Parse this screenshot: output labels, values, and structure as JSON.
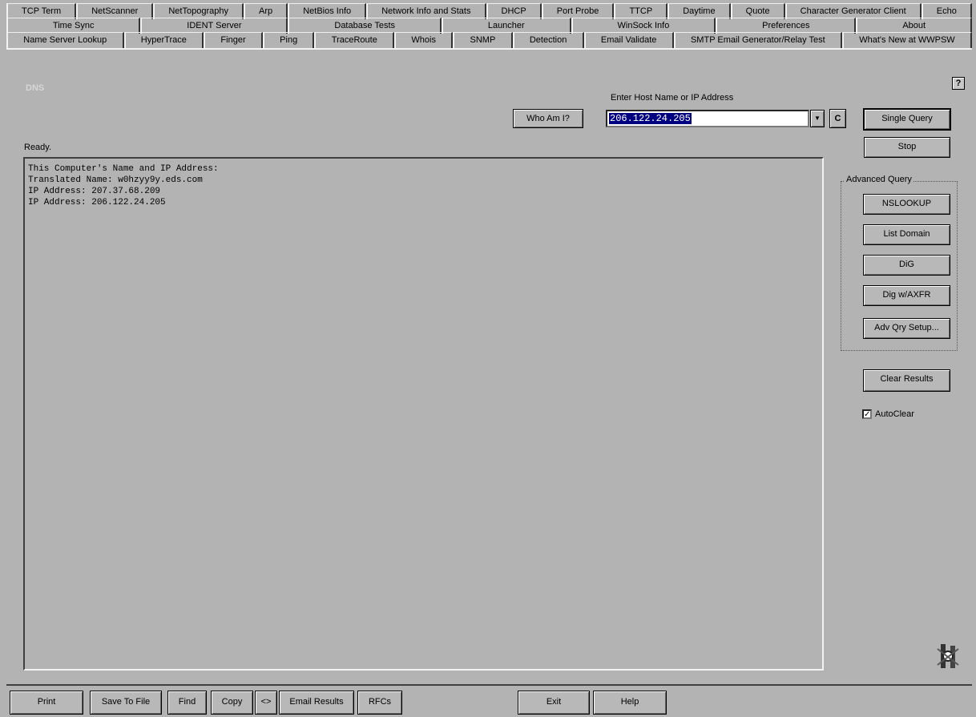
{
  "tabs": {
    "row1": [
      "TCP Term",
      "NetScanner",
      "NetTopography",
      "Arp",
      "NetBios Info",
      "Network Info and Stats",
      "DHCP",
      "Port Probe",
      "TTCP",
      "Daytime",
      "Quote",
      "Character Generator Client",
      "Echo"
    ],
    "row2": [
      "Time Sync",
      "IDENT Server",
      "Database Tests",
      "Launcher",
      "WinSock Info",
      "Preferences",
      "About"
    ],
    "row3": [
      "Name Server Lookup",
      "HyperTrace",
      "Finger",
      "Ping",
      "TraceRoute",
      "Whois",
      "SNMP",
      "Detection",
      "Email Validate",
      "SMTP Email Generator/Relay Test",
      "What's New at WWPSW"
    ],
    "active": "Name Server Lookup"
  },
  "header": {
    "faded_label": "DNS",
    "host_label": "Enter Host Name or IP Address",
    "host_value": "206.122.24.205",
    "whoami_label": "Who Am I?",
    "clear_host_label": "C",
    "single_query_label": "Single Query",
    "stop_label": "Stop",
    "help_label": "?"
  },
  "status_text": "Ready.",
  "results": [
    "This Computer's Name and IP Address:",
    "Translated Name: w0hzyy9y.eds.com",
    "IP Address: 207.37.68.209",
    "IP Address: 206.122.24.205"
  ],
  "advanced": {
    "legend": "Advanced Query",
    "buttons": [
      "NSLOOKUP",
      "List Domain",
      "DiG",
      "Dig w/AXFR",
      "Adv Qry Setup..."
    ]
  },
  "clear_results_label": "Clear Results",
  "autoclear": {
    "label": "AutoClear",
    "checked": true
  },
  "bottom": {
    "print": "Print",
    "save": "Save To File",
    "find": "Find",
    "copy": "Copy",
    "arrows": "<>",
    "email": "Email Results",
    "rfcs": "RFCs",
    "exit": "Exit",
    "help": "Help"
  }
}
